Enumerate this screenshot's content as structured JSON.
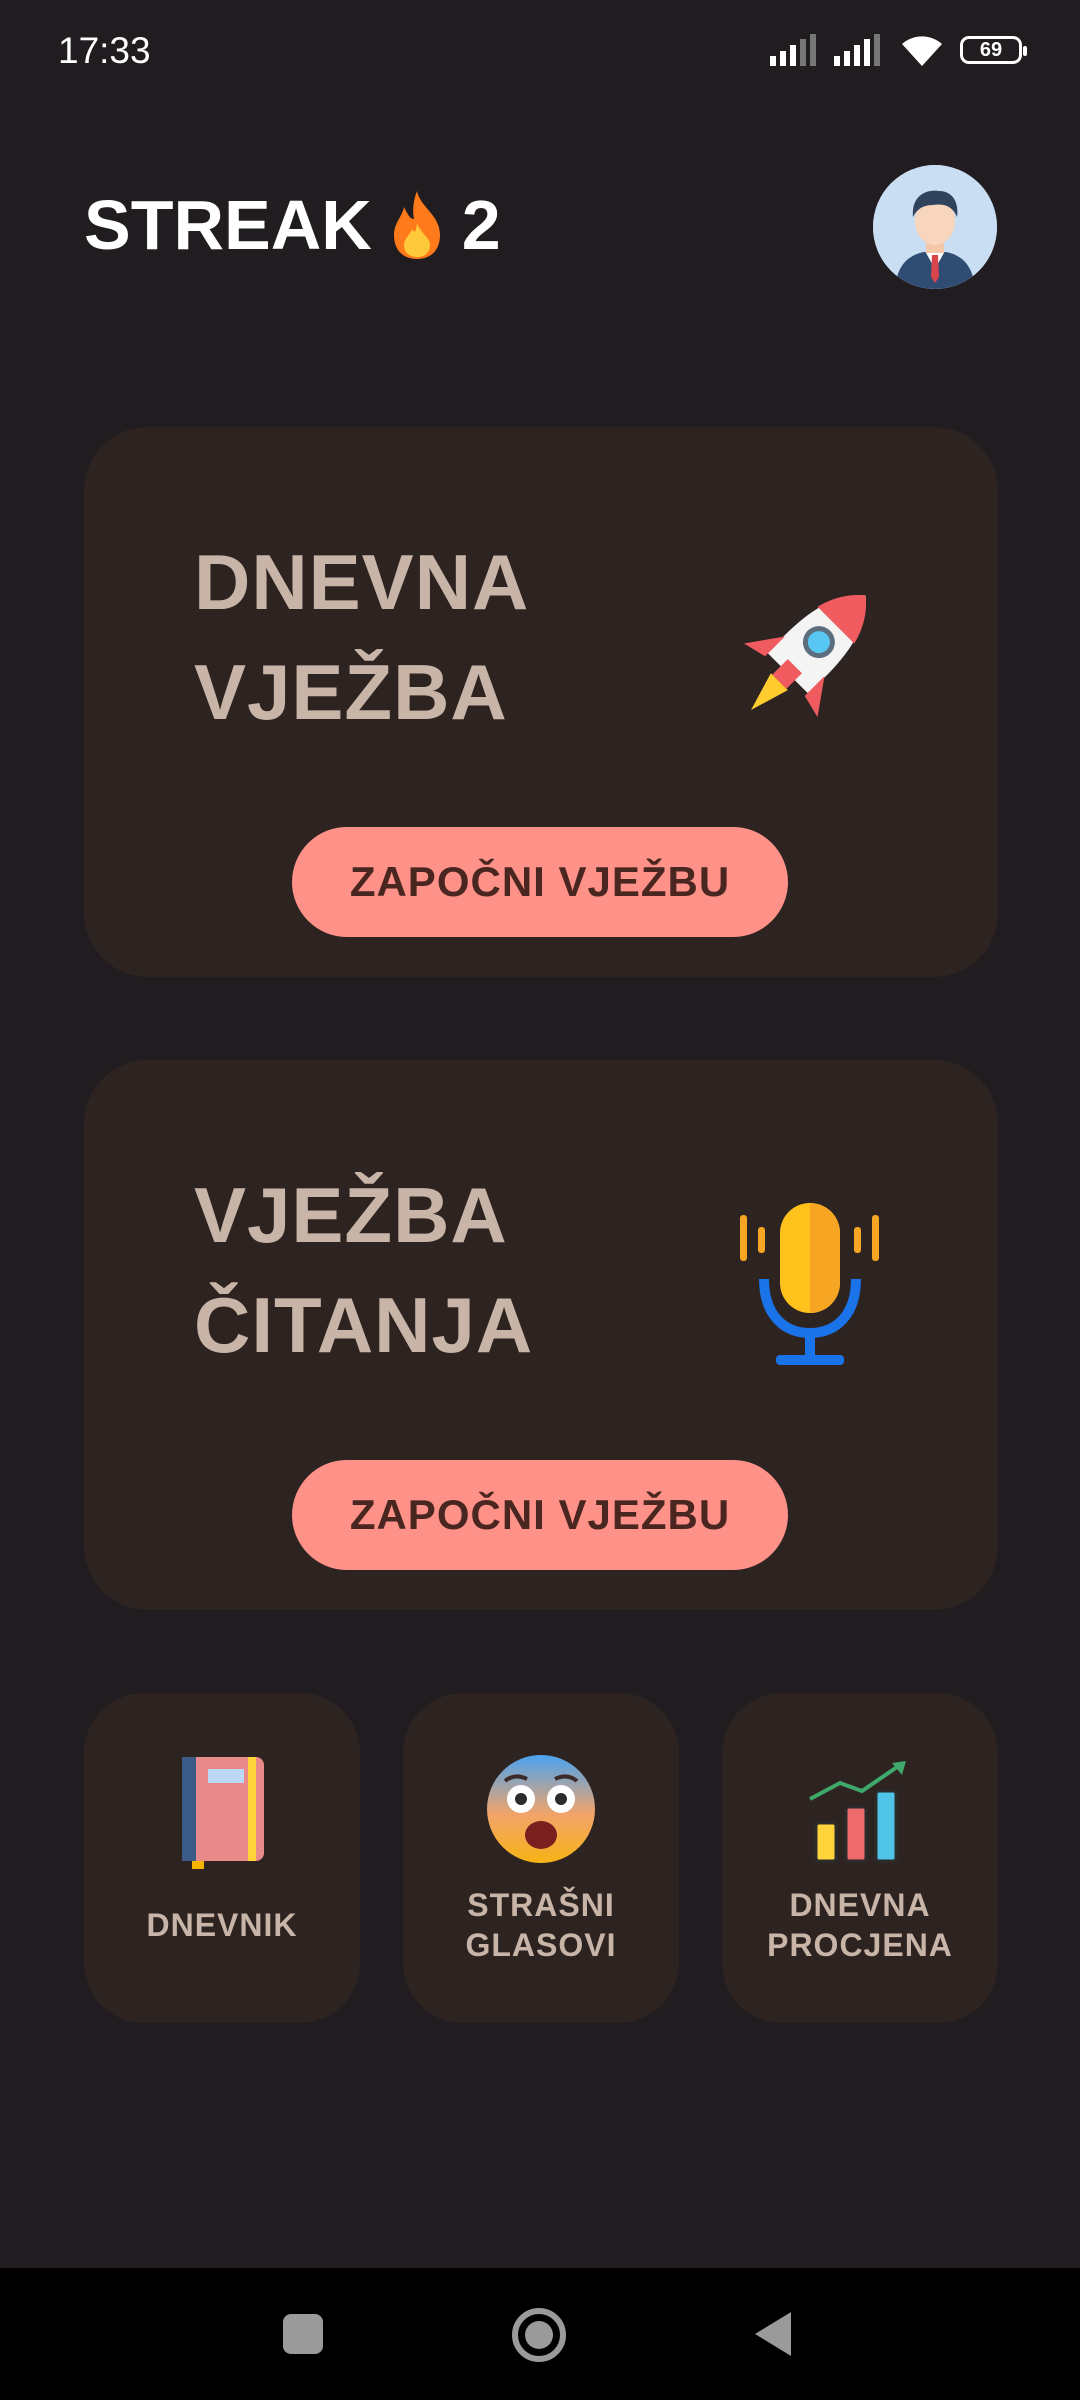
{
  "status_bar": {
    "time": "17:33",
    "battery": "69"
  },
  "header": {
    "streak_label": "STREAK",
    "streak_count": "2"
  },
  "cards": [
    {
      "title_line1": "DNEVNA",
      "title_line2": "VJEŽBA",
      "button_label": "ZAPOČNI VJEŽBU",
      "icon": "rocket-icon"
    },
    {
      "title_line1": "VJEŽBA",
      "title_line2": "ČITANJA",
      "button_label": "ZAPOČNI VJEŽBU",
      "icon": "microphone-icon"
    }
  ],
  "tiles": [
    {
      "label_line1": "DNEVNIK",
      "label_line2": "",
      "icon": "notebook-icon"
    },
    {
      "label_line1": "STRAŠNI",
      "label_line2": "GLASOVI",
      "icon": "fearful-face-icon"
    },
    {
      "label_line1": "DNEVNA",
      "label_line2": "PROCJENA",
      "icon": "chart-icon"
    }
  ],
  "colors": {
    "background": "#201c1f",
    "card": "#2d2421",
    "button": "#ff9288",
    "title_text": "#c8b5a8"
  }
}
